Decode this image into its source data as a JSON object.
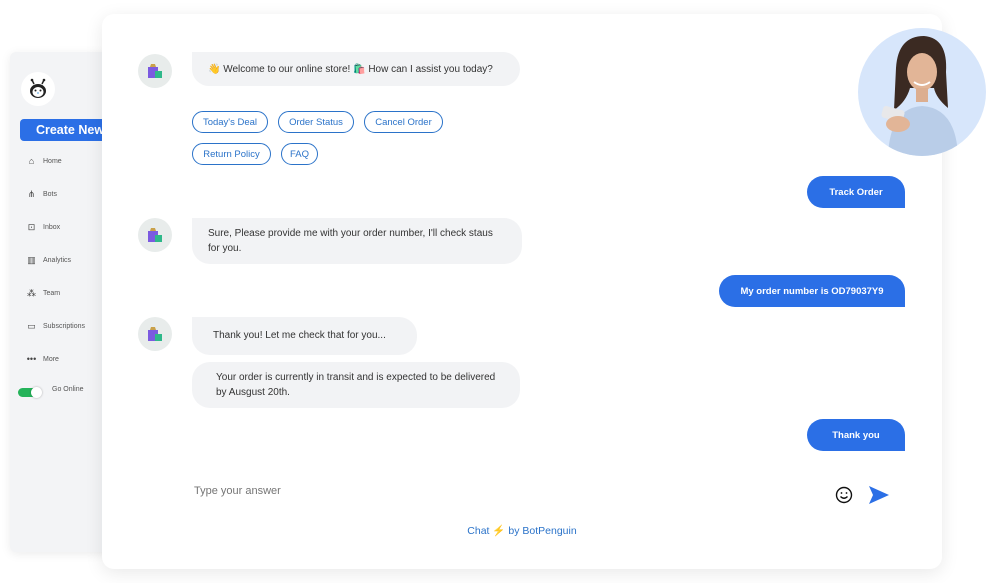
{
  "sidebar": {
    "create_label": "Create New",
    "items": [
      {
        "label": "Home",
        "icon": "home-icon"
      },
      {
        "label": "Bots",
        "icon": "bots-icon",
        "has_caret": true
      },
      {
        "label": "Inbox",
        "icon": "inbox-icon"
      },
      {
        "label": "Analytics",
        "icon": "analytics-icon"
      },
      {
        "label": "Team",
        "icon": "team-icon"
      },
      {
        "label": "Subscriptions",
        "icon": "subscriptions-icon"
      },
      {
        "label": "More",
        "icon": "more-icon",
        "has_caret": true
      }
    ],
    "go_online_label": "Go Online",
    "go_online_on": true
  },
  "chat": {
    "messages": {
      "welcome": "👋 Welcome to our online store! 🛍️ How can I assist you today?",
      "provide": "Sure, Please provide me with your order number, I'll check staus for you.",
      "thanks_check": "Thank you! Let me check that for you...",
      "transit": "Your order is currently in transit and is expected to be delivered by Ausgust 20th."
    },
    "quick_replies": [
      "Today's Deal",
      "Order Status",
      "Cancel Order",
      "Return Policy",
      "FAQ"
    ],
    "user_messages": {
      "track": "Track Order",
      "order_number": "My order number is  OD79037Y9",
      "thank_you": "Thank you"
    },
    "input_placeholder": "Type your answer",
    "footer": {
      "prefix": "Chat",
      "bolt": "⚡",
      "suffix": "by BotPenguin"
    }
  },
  "colors": {
    "accent": "#2b6fe6",
    "chip": "#2b73c9",
    "toggle": "#25b35a"
  }
}
